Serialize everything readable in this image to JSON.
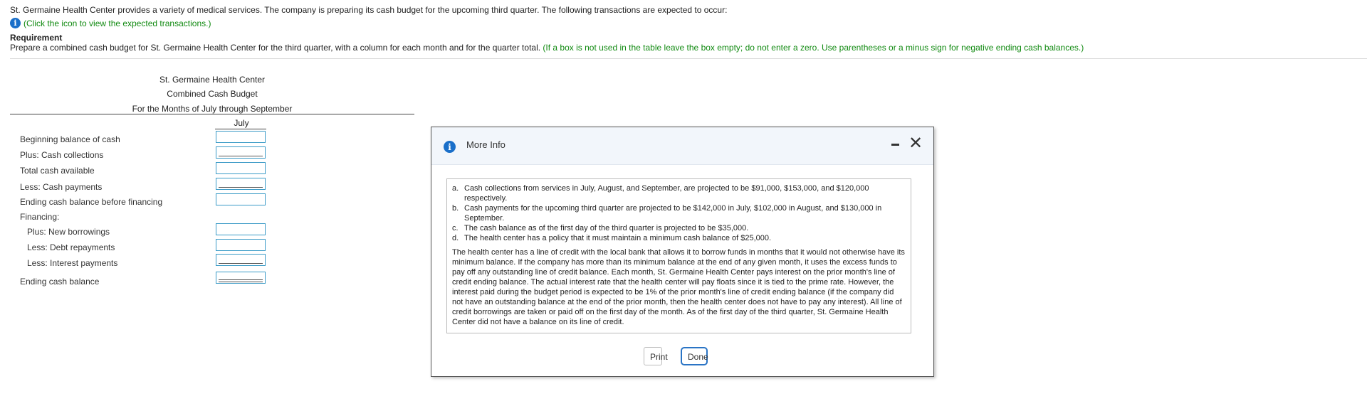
{
  "problem": {
    "intro": "St. Germaine Health Center provides a variety of medical services. The company is preparing its cash budget for the upcoming third quarter. The following transactions are expected to occur:",
    "link_text": "(Click the icon to view the expected transactions.)",
    "requirement_heading": "Requirement",
    "requirement_text": "Prepare a combined cash budget for St. Germaine Health Center for the third quarter, with a column for each month and for the quarter total.",
    "requirement_note": "(If a box is not used in the table leave the box empty; do not enter a zero. Use parentheses or a minus sign for negative ending cash balances.)"
  },
  "budget": {
    "title_company": "St. Germaine Health Center",
    "title_report": "Combined Cash Budget",
    "title_period": "For the Months of July through September",
    "column_header": "July",
    "rows": [
      {
        "label": "Beginning balance of cash"
      },
      {
        "label": "Plus: Cash collections"
      },
      {
        "label": "Total cash available"
      },
      {
        "label": "Less: Cash payments"
      },
      {
        "label": "Ending cash balance before financing"
      },
      {
        "label": "Financing:"
      },
      {
        "label": "Plus: New borrowings"
      },
      {
        "label": "Less: Debt repayments"
      },
      {
        "label": "Less: Interest payments"
      },
      {
        "label": "Ending cash balance"
      }
    ]
  },
  "modal": {
    "title": "More Info",
    "items": [
      {
        "letter": "a.",
        "text": "Cash collections from services in July, August, and September, are projected to be $91,000, $153,000, and $120,000 respectively."
      },
      {
        "letter": "b.",
        "text": "Cash payments for the upcoming third quarter are projected to be $142,000 in July, $102,000 in August, and $130,000 in September."
      },
      {
        "letter": "c.",
        "text": "The cash balance as of the first day of the third quarter is projected to be $35,000."
      },
      {
        "letter": "d.",
        "text": "The health center has a policy that it must maintain a minimum cash balance of $25,000."
      }
    ],
    "paragraph": "The health center has a line of credit with the local bank that allows it to borrow funds in months that it would not otherwise have its minimum balance. If the company has more than its minimum balance at the end of any given month, it uses the excess funds to pay off any outstanding line of credit balance. Each month, St. Germaine Health Center pays interest on the prior month's line of credit ending balance. The actual interest rate that the health center will pay floats since it is tied to the prime rate. However, the interest paid during the budget period is expected to be 1% of the prior month's line of credit ending balance (if the company did not have an outstanding balance at the end of the prior month, then the health center does not have to pay any interest). All line of credit borrowings are taken or paid off on the first day of the month. As of the first day of the third quarter, St. Germaine Health Center did not have a balance on its line of credit.",
    "print_label": "Print",
    "done_label": "Done"
  }
}
